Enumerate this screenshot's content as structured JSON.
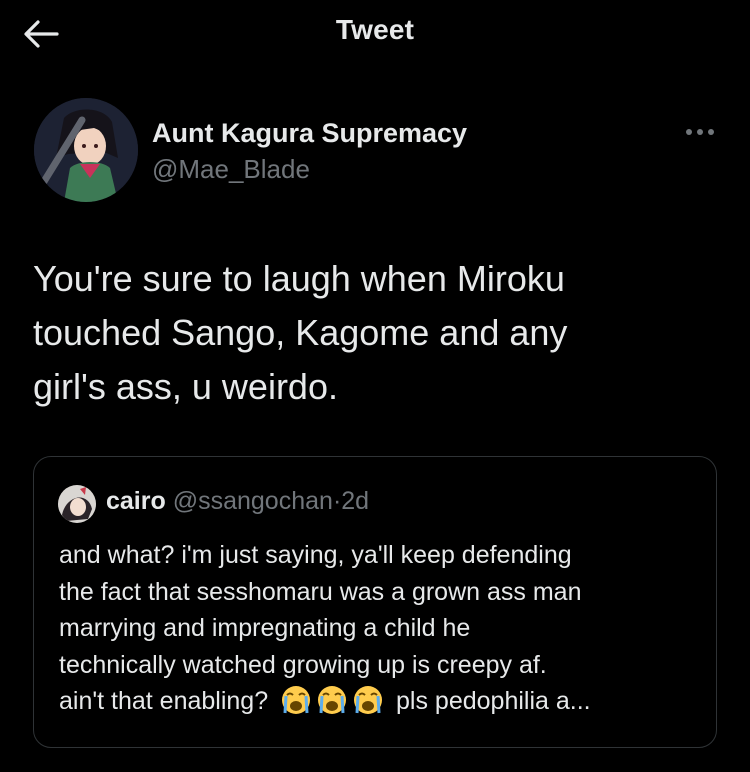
{
  "header": {
    "title": "Tweet",
    "back_icon": "arrow-left-icon"
  },
  "author": {
    "name": "Aunt Kagura Supremacy",
    "handle": "@Mae_Blade"
  },
  "tweet": {
    "lines": [
      "You're sure to laugh when Miroku",
      "touched Sango, Kagome and any",
      "girl's ass, u weirdo."
    ]
  },
  "quote": {
    "name": "cairo",
    "handle": "@ssangochan",
    "separator": "·",
    "time": "2d",
    "lines": [
      "and what? i'm just saying, ya'll keep defending",
      "the fact that sesshomaru was a grown ass man",
      "marrying and impregnating a child he",
      "technically watched growing up is creepy af."
    ],
    "last_line_start": "ain't that enabling?",
    "emoji": [
      "loudly-crying-face",
      "loudly-crying-face",
      "loudly-crying-face"
    ],
    "last_line_end": "pls pedophilia a..."
  },
  "colors": {
    "background": "#000000",
    "text": "#e7e9ea",
    "muted": "#71767b",
    "border": "#2f3336"
  }
}
